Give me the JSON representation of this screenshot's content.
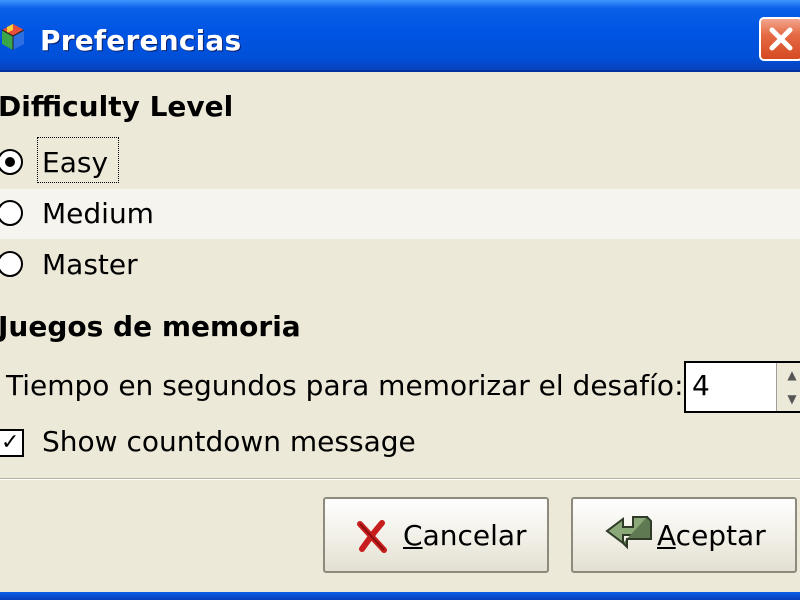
{
  "window": {
    "title": "Preferencias",
    "app_icon": "gnome-sudoku-cube-icon",
    "close_icon": "close-x-icon"
  },
  "difficulty": {
    "header": "Difficulty Level",
    "options": [
      {
        "label": "Easy",
        "selected": true
      },
      {
        "label": "Medium",
        "selected": false
      },
      {
        "label": "Master",
        "selected": false
      }
    ]
  },
  "memory": {
    "header": "Juegos de memoria",
    "time_label": "Tiempo en segundos para memorizar el desafío:",
    "time_value": "4",
    "countdown_label": "Show countdown message",
    "countdown_checked": true
  },
  "buttons": {
    "cancel_mnemonic": "C",
    "cancel_rest": "ancelar",
    "cancel_icon": "red-x-icon",
    "accept_mnemonic": "A",
    "accept_rest": "ceptar",
    "accept_icon": "enter-arrow-icon"
  },
  "colors": {
    "titlebar": "#0054e3",
    "window_bg": "#ece9d8",
    "close_button": "#e56a44",
    "cancel_icon": "#c81e1e",
    "accept_icon": "#8aa878"
  }
}
